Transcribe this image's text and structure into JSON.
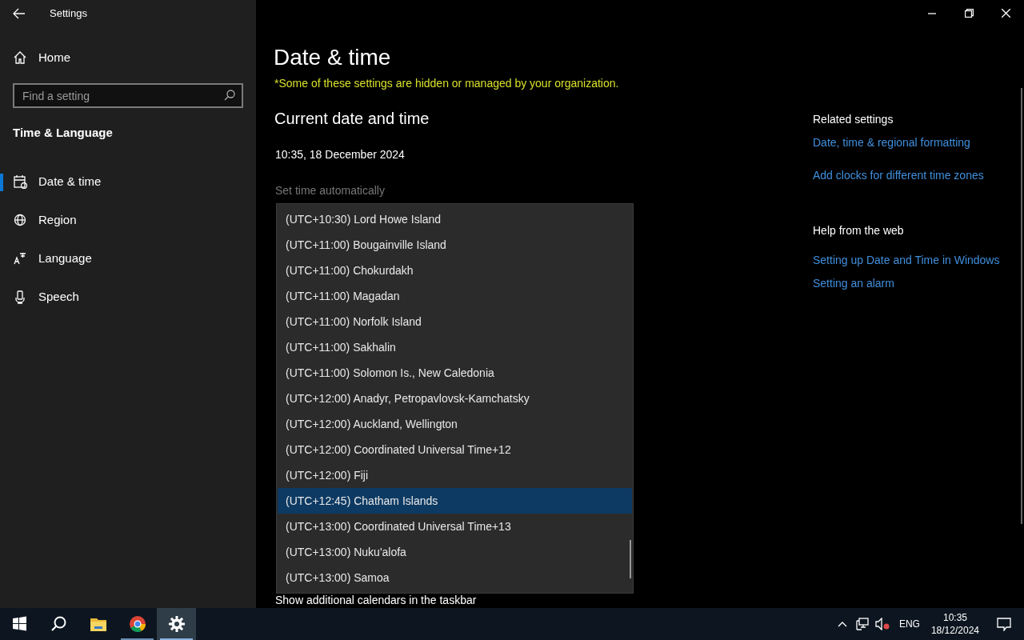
{
  "window": {
    "title": "Settings",
    "controls": [
      {
        "kind": "minimize"
      },
      {
        "kind": "restore"
      },
      {
        "kind": "close"
      }
    ]
  },
  "sidebar": {
    "home": "Home",
    "search": {
      "placeholder": "Find a setting"
    },
    "section": "Time & Language",
    "items": [
      {
        "label": "Date & time",
        "selected": true
      },
      {
        "label": "Region",
        "selected": false
      },
      {
        "label": "Language",
        "selected": false
      },
      {
        "label": "Speech",
        "selected": false
      }
    ]
  },
  "main": {
    "title": "Date & time",
    "notice": "*Some of these settings are hidden or managed by your organization.",
    "section": "Current date and time",
    "current": "10:35, 18 December 2024",
    "set_time_label": "Set time automatically",
    "below_label": "Show additional calendars in the taskbar",
    "timezone_list": [
      {
        "label": "(UTC+10:30) Lord Howe Island",
        "selected": false
      },
      {
        "label": "(UTC+11:00) Bougainville Island",
        "selected": false
      },
      {
        "label": "(UTC+11:00) Chokurdakh",
        "selected": false
      },
      {
        "label": "(UTC+11:00) Magadan",
        "selected": false
      },
      {
        "label": "(UTC+11:00) Norfolk Island",
        "selected": false
      },
      {
        "label": "(UTC+11:00) Sakhalin",
        "selected": false
      },
      {
        "label": "(UTC+11:00) Solomon Is., New Caledonia",
        "selected": false
      },
      {
        "label": "(UTC+12:00) Anadyr, Petropavlovsk-Kamchatsky",
        "selected": false
      },
      {
        "label": "(UTC+12:00) Auckland, Wellington",
        "selected": false
      },
      {
        "label": "(UTC+12:00) Coordinated Universal Time+12",
        "selected": false
      },
      {
        "label": "(UTC+12:00) Fiji",
        "selected": false
      },
      {
        "label": "(UTC+12:45) Chatham Islands",
        "selected": true
      },
      {
        "label": "(UTC+13:00) Coordinated Universal Time+13",
        "selected": false
      },
      {
        "label": "(UTC+13:00) Nuku'alofa",
        "selected": false
      },
      {
        "label": "(UTC+13:00) Samoa",
        "selected": false
      }
    ]
  },
  "related": {
    "title": "Related settings",
    "links": [
      "Date, time & regional formatting",
      "Add clocks for different time zones"
    ]
  },
  "help": {
    "title": "Help from the web",
    "links": [
      "Setting up Date and Time in Windows",
      "Setting an alarm"
    ]
  },
  "taskbar": {
    "apps": [
      {
        "kind": "start",
        "selected": false
      },
      {
        "kind": "search",
        "selected": false
      },
      {
        "kind": "folder",
        "selected": false
      },
      {
        "kind": "browser",
        "selected": false
      },
      {
        "kind": "settings",
        "selected": true
      }
    ],
    "language": "ENG",
    "time": "10:35",
    "date": "18/12/2024"
  }
}
